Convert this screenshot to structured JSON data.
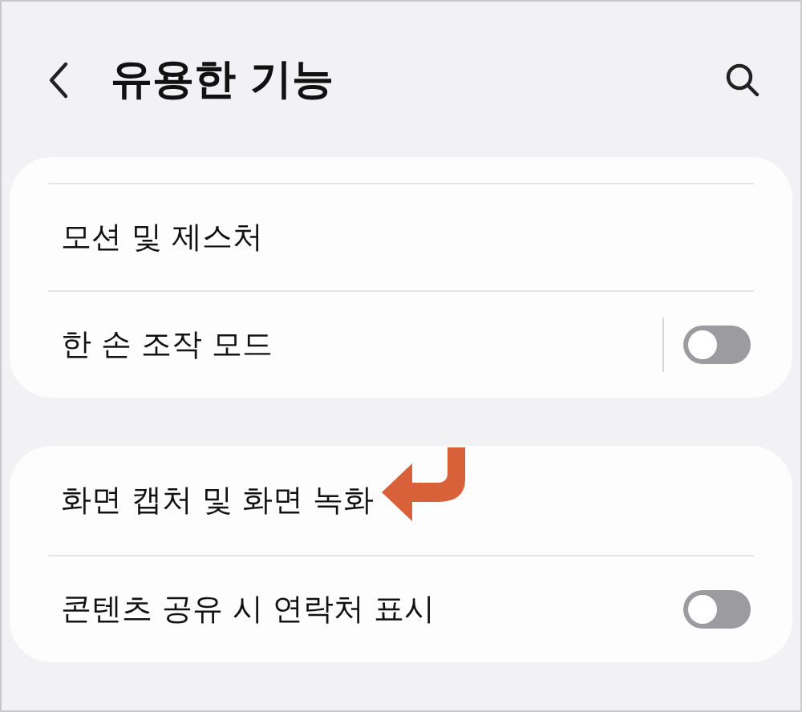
{
  "header": {
    "title": "유용한 기능"
  },
  "cards": [
    {
      "cut_top": true,
      "rows": [
        {
          "kind": "link",
          "label": "모션 및 제스처",
          "annotated": false
        },
        {
          "kind": "toggle",
          "label": "한 손 조작 모드",
          "on": false,
          "separator": true
        }
      ]
    },
    {
      "cut_top": false,
      "rows": [
        {
          "kind": "link",
          "label": "화면 캡처 및 화면 녹화",
          "annotated": true
        },
        {
          "kind": "toggle",
          "label": "콘텐츠 공유 시 연락처 표시",
          "on": false,
          "separator": false
        }
      ]
    }
  ]
}
